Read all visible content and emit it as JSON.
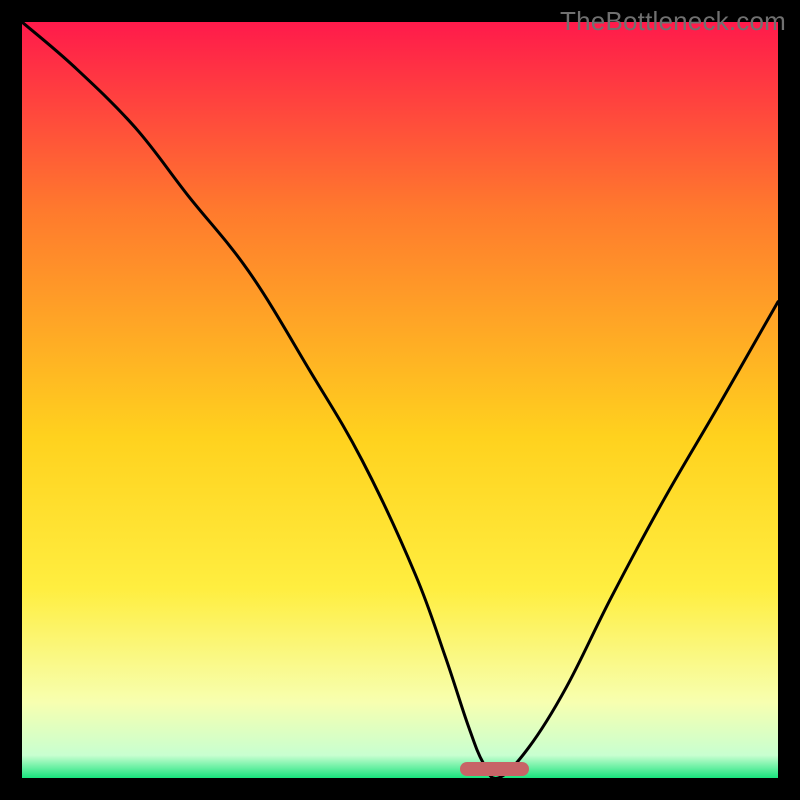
{
  "watermark": "TheBottleneck.com",
  "colors": {
    "bg_top": "#ff1a4b",
    "bg_mid_upper": "#ff7a2d",
    "bg_mid": "#ffd21e",
    "bg_mid_lower": "#ffee40",
    "bg_lower": "#f7ffb0",
    "bg_green": "#18e37d",
    "curve": "#000000",
    "marker": "#c76467",
    "frame": "#000000"
  },
  "chart_data": {
    "type": "line",
    "title": "",
    "xlabel": "",
    "ylabel": "",
    "xlim": [
      0,
      100
    ],
    "ylim": [
      0,
      100
    ],
    "series": [
      {
        "name": "bottleneck-curve",
        "x": [
          0,
          7,
          15,
          22,
          30,
          38,
          45,
          52,
          56,
          59,
          61,
          63,
          67,
          72,
          78,
          85,
          92,
          100
        ],
        "values": [
          100,
          94,
          86,
          77,
          67,
          54,
          42,
          27,
          16,
          7,
          2,
          0,
          4,
          12,
          24,
          37,
          49,
          63
        ]
      }
    ],
    "marker": {
      "x_start": 58,
      "x_end": 67,
      "y": 0
    },
    "gradient_stops": [
      {
        "pos": 0,
        "color": "#ff1a4b"
      },
      {
        "pos": 25,
        "color": "#ff7a2d"
      },
      {
        "pos": 55,
        "color": "#ffd21e"
      },
      {
        "pos": 75,
        "color": "#ffee40"
      },
      {
        "pos": 90,
        "color": "#f7ffb0"
      },
      {
        "pos": 97,
        "color": "#c8ffd0"
      },
      {
        "pos": 100,
        "color": "#18e37d"
      }
    ]
  }
}
